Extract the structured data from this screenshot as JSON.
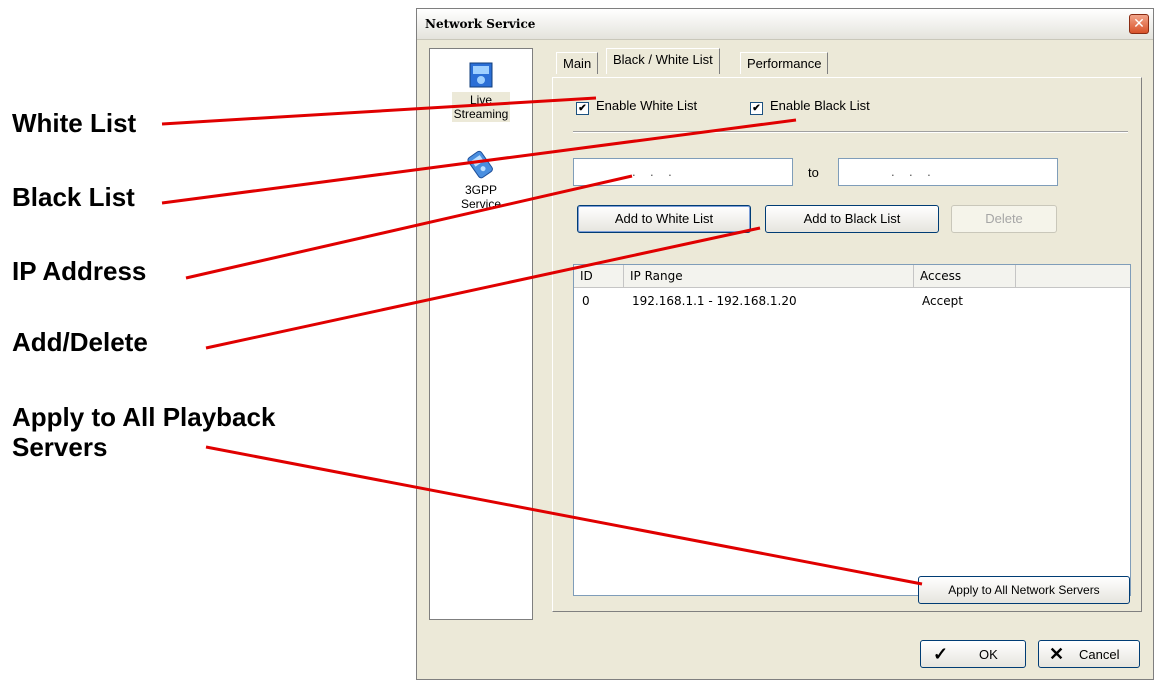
{
  "callouts": {
    "white_list": "White List",
    "black_list": "Black List",
    "ip_address": "IP Address",
    "add_delete": "Add/Delete",
    "apply_all_line1": "Apply to All Playback",
    "apply_all_line2": "Servers"
  },
  "dialog": {
    "title": "Network Service",
    "close_icon": "close-icon"
  },
  "services": [
    {
      "label_line1": "Live",
      "label_line2": "Streaming",
      "icon": "live-streaming-icon",
      "selected": true
    },
    {
      "label_line1": "3GPP",
      "label_line2": "Service",
      "icon": "3gpp-service-icon",
      "selected": false
    }
  ],
  "tabs": [
    {
      "label": "Main"
    },
    {
      "label": "Black / White List",
      "active": true
    },
    {
      "label": "Performance"
    }
  ],
  "checkboxes": {
    "white": {
      "label": "Enable White List",
      "checked": true
    },
    "black": {
      "label": "Enable Black List",
      "checked": true
    },
    "check_mark": "✔"
  },
  "ip_range": {
    "from_value": ".    .    .",
    "to_label": "to",
    "to_value": ".    .    ."
  },
  "buttons": {
    "add_white": "Add to White List",
    "add_black": "Add to Black List",
    "delete": "Delete",
    "apply_all": "Apply to All Network Servers",
    "ok": "OK",
    "cancel": "Cancel"
  },
  "table": {
    "columns": [
      "ID",
      "IP Range",
      "Access"
    ],
    "rows": [
      {
        "id": "0",
        "ip_range": "192.168.1.1 - 192.168.1.20",
        "access": "Accept"
      }
    ]
  },
  "colors": {
    "callout_line": "#e00000",
    "dialog_bg": "#ece9d8"
  }
}
